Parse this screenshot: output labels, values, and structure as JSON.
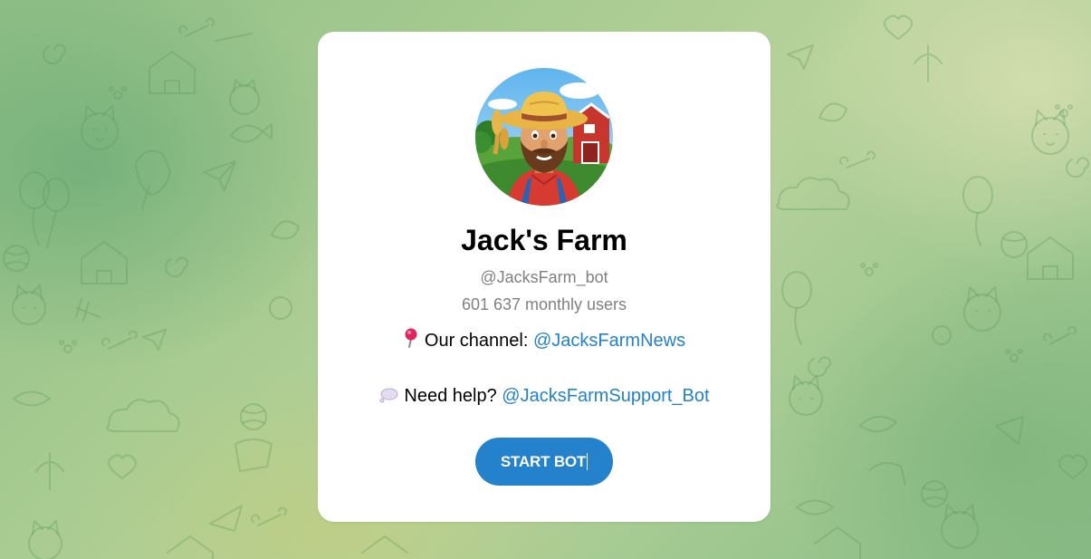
{
  "bot": {
    "name": "Jack's Farm",
    "username": "@JacksFarm_bot",
    "monthly_users": "601 637 monthly users",
    "avatar_icon": "farmer-avatar"
  },
  "description": {
    "channel_emoji": "round-pushpin",
    "channel_label": "Our channel:",
    "channel_link": "@JacksFarmNews",
    "help_emoji": "thought-balloon",
    "help_label": "Need help?",
    "help_link": "@JacksFarmSupport_Bot"
  },
  "start_button": {
    "label": "START BOT"
  },
  "colors": {
    "accent": "#2481cc",
    "card": "#ffffff",
    "muted_text": "#808080"
  }
}
